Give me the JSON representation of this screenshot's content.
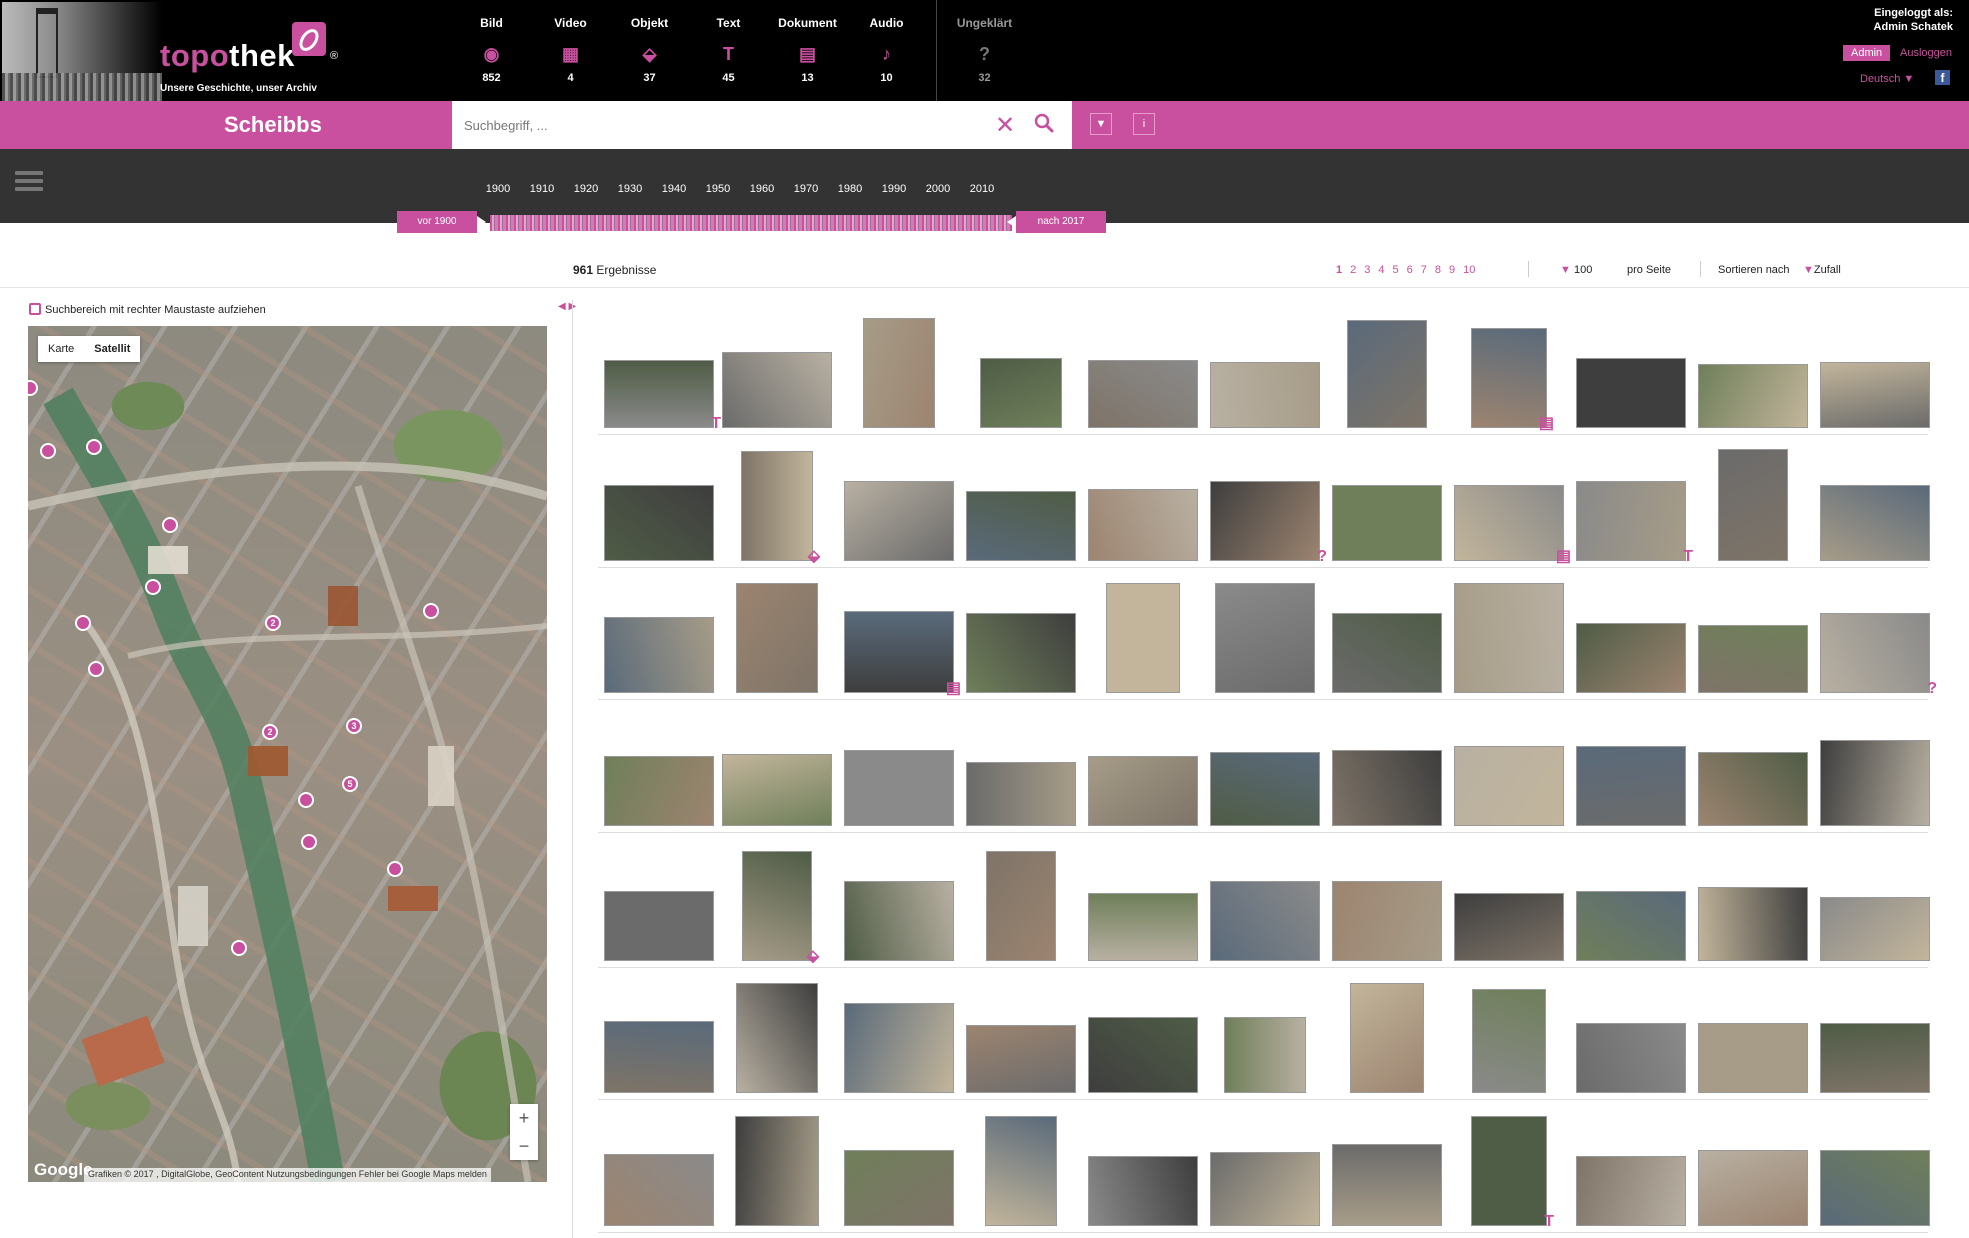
{
  "header": {
    "logo_text_a": "topo",
    "logo_text_b": "thek",
    "logo_reg": "®",
    "tagline": "Unsere Geschichte, unser Archiv",
    "mediatypes": [
      {
        "label": "Bild",
        "count": "852",
        "icon": "◉"
      },
      {
        "label": "Video",
        "count": "4",
        "icon": "▦"
      },
      {
        "label": "Objekt",
        "count": "37",
        "icon": "⬙"
      },
      {
        "label": "Text",
        "count": "45",
        "icon": "T"
      },
      {
        "label": "Dokument",
        "count": "13",
        "icon": "▤"
      },
      {
        "label": "Audio",
        "count": "10",
        "icon": "♪"
      }
    ],
    "unclear": {
      "label": "Ungeklärt",
      "count": "32",
      "icon": "?"
    },
    "login_line1": "Eingeloggt als:",
    "login_line2": "Admin Schatek",
    "admin_label": "Admin",
    "logout_label": "Ausloggen",
    "language": "Deutsch ▼",
    "fb_label": "f"
  },
  "searchbar": {
    "place": "Scheibbs",
    "placeholder": "Suchbegriff, ...",
    "clear": "✕",
    "filter_btn": "▼",
    "info_btn": "i"
  },
  "timeline": {
    "years": [
      "1900",
      "1910",
      "1920",
      "1930",
      "1940",
      "1950",
      "1960",
      "1970",
      "1980",
      "1990",
      "2000",
      "2010"
    ],
    "left_handle": "vor 1900",
    "right_handle": "nach 2017"
  },
  "results": {
    "count": "961",
    "count_label": "Ergebnisse",
    "pages": [
      "1",
      "2",
      "3",
      "4",
      "5",
      "6",
      "7",
      "8",
      "9",
      "10"
    ],
    "per_page_value": "100",
    "per_page_label": "pro Seite",
    "sort_label": "Sortieren nach",
    "sort_value": "Zufall"
  },
  "map": {
    "hint": "Suchbereich mit rechter Maustaste aufziehen",
    "collapse": "◀ ▶",
    "toggle_map": "Karte",
    "toggle_sat": "Satellit",
    "zoom_in": "+",
    "zoom_out": "−",
    "google": "Google",
    "attribution": "Grafiken © 2017 , DigitalGlobe, GeoContent   Nutzungsbedingungen   Fehler bei Google Maps melden",
    "markers": [
      {
        "label": ""
      },
      {
        "label": ""
      },
      {
        "label": ""
      },
      {
        "label": ""
      },
      {
        "label": ""
      },
      {
        "label": "2"
      },
      {
        "label": ""
      },
      {
        "label": ""
      },
      {
        "label": "2"
      },
      {
        "label": "3"
      },
      {
        "label": "5"
      },
      {
        "label": ""
      },
      {
        "label": ""
      },
      {
        "label": ""
      },
      {
        "label": ""
      },
      {
        "label": ""
      },
      {
        "label": ""
      }
    ]
  },
  "gallery": {
    "badge_icons": {
      "text": "T",
      "doc": "▤",
      "object": "⬙",
      "unclear": "?"
    }
  }
}
